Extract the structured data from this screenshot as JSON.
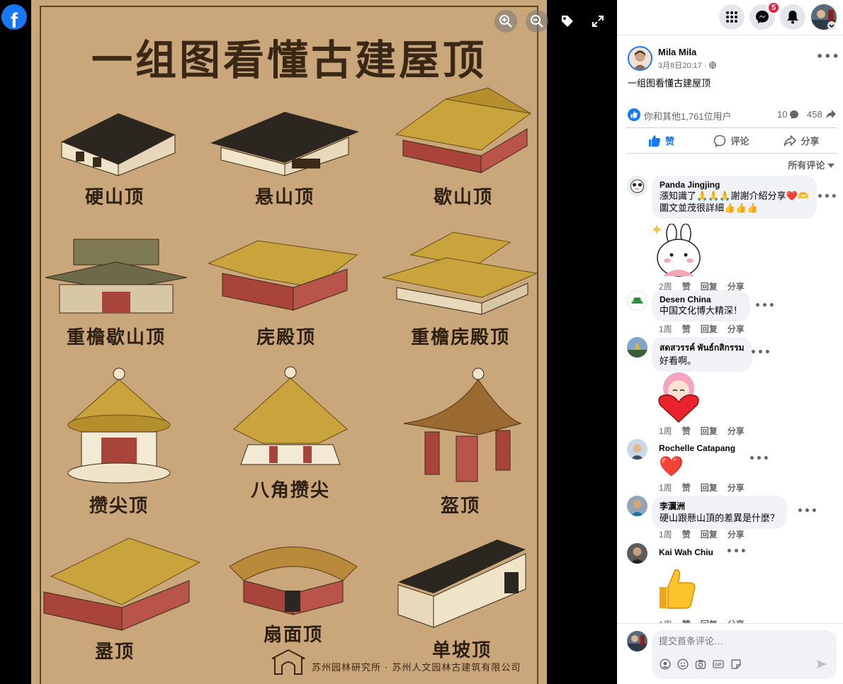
{
  "app": {
    "logo_letter": "f"
  },
  "viewer": {
    "poster": {
      "title": "一组图看懂古建屋顶",
      "buildings": [
        {
          "label": "硬山顶"
        },
        {
          "label": "悬山顶"
        },
        {
          "label": "歇山顶"
        },
        {
          "label": "重檐歇山顶"
        },
        {
          "label": "庑殿顶"
        },
        {
          "label": "重檐庑殿顶"
        },
        {
          "label": "攒尖顶"
        },
        {
          "label": "八角攒尖"
        },
        {
          "label": "盔顶"
        },
        {
          "label": "盝顶"
        },
        {
          "label": "扇面顶"
        },
        {
          "label": "单坡顶"
        }
      ],
      "footer": "苏州园林研究所 · 苏州人文园林古建筑有限公司"
    }
  },
  "topbar": {
    "messenger_badge": "5"
  },
  "post": {
    "author": "Mila Mila",
    "date": "3月8日20:17 ·",
    "text": "一组图看懂古建屋顶",
    "reactions_text": "你和其他1,761位用户",
    "comments_count": "10",
    "shares_count": "458",
    "actions": {
      "like": "赞",
      "comment": "评论",
      "share": "分享"
    },
    "filter_label": "所有评论"
  },
  "comment_actions": {
    "like": "赞",
    "reply": "回复",
    "share": "分享"
  },
  "comments": [
    {
      "name": "Panda Jingjing",
      "lines": [
        "漲知識了🙏🙏🙏謝謝介紹分享❤️🫶",
        "圖文並茂很詳細👍👍👍"
      ],
      "time": "2周"
    },
    {
      "name": "Desen China",
      "lines": [
        "中国文化博大精深！"
      ],
      "time": "1周"
    },
    {
      "name": "สดสวรรค์ พันธ์กสิกรรม",
      "lines": [
        "好看啊。"
      ],
      "time": "1周"
    },
    {
      "name": "Rochelle Catapang",
      "lines": [
        "❤️"
      ],
      "time": "1周"
    },
    {
      "name": "李瀷洲",
      "lines": [
        "硬山跟懸山頂的差異是什麼？"
      ],
      "time": "1周"
    },
    {
      "name": "Kai Wah Chiu",
      "lines": [],
      "time": "1周"
    }
  ],
  "composer": {
    "placeholder": "提交首条评论…"
  },
  "colors": {
    "brand": "#1877f2",
    "badge": "#e41e3f",
    "poster_bg": "#c9a77a"
  }
}
